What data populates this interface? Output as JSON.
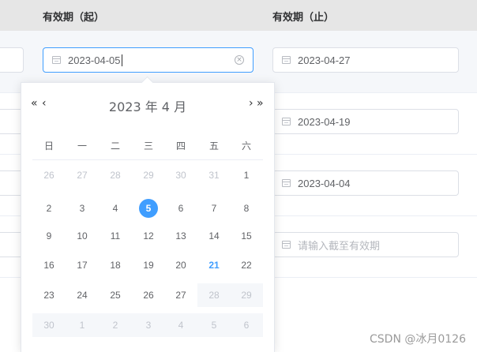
{
  "table": {
    "headers": [
      "有效期（起）",
      "有效期（止）"
    ]
  },
  "start_inputs": [
    {
      "value": "2023-04-05",
      "focused": true
    }
  ],
  "end_inputs": [
    {
      "value": "2023-04-27"
    },
    {
      "value": "2023-04-19"
    },
    {
      "value": "2023-04-04"
    },
    {
      "value": "",
      "placeholder": "请输入截至有效期"
    }
  ],
  "datepicker": {
    "prev_year": "«",
    "prev_month": "‹",
    "next_month": "›",
    "next_year": "»",
    "title": "2023 年  4 月",
    "weekdays": [
      "日",
      "一",
      "二",
      "三",
      "四",
      "五",
      "六"
    ],
    "weeks": [
      [
        {
          "d": "26",
          "s": "muted"
        },
        {
          "d": "27",
          "s": "muted"
        },
        {
          "d": "28",
          "s": "muted"
        },
        {
          "d": "29",
          "s": "muted"
        },
        {
          "d": "30",
          "s": "muted"
        },
        {
          "d": "31",
          "s": "muted"
        },
        {
          "d": "1",
          "s": ""
        }
      ],
      [
        {
          "d": "2",
          "s": ""
        },
        {
          "d": "3",
          "s": ""
        },
        {
          "d": "4",
          "s": ""
        },
        {
          "d": "5",
          "s": "selected"
        },
        {
          "d": "6",
          "s": ""
        },
        {
          "d": "7",
          "s": ""
        },
        {
          "d": "8",
          "s": ""
        }
      ],
      [
        {
          "d": "9",
          "s": ""
        },
        {
          "d": "10",
          "s": ""
        },
        {
          "d": "11",
          "s": ""
        },
        {
          "d": "12",
          "s": ""
        },
        {
          "d": "13",
          "s": ""
        },
        {
          "d": "14",
          "s": ""
        },
        {
          "d": "15",
          "s": ""
        }
      ],
      [
        {
          "d": "16",
          "s": ""
        },
        {
          "d": "17",
          "s": ""
        },
        {
          "d": "18",
          "s": ""
        },
        {
          "d": "19",
          "s": ""
        },
        {
          "d": "20",
          "s": ""
        },
        {
          "d": "21",
          "s": "today"
        },
        {
          "d": "22",
          "s": ""
        }
      ],
      [
        {
          "d": "23",
          "s": ""
        },
        {
          "d": "24",
          "s": ""
        },
        {
          "d": "25",
          "s": ""
        },
        {
          "d": "26",
          "s": ""
        },
        {
          "d": "27",
          "s": ""
        },
        {
          "d": "28",
          "s": "disabled"
        },
        {
          "d": "29",
          "s": "disabled"
        }
      ],
      [
        {
          "d": "30",
          "s": "disabled"
        },
        {
          "d": "1",
          "s": "disabled"
        },
        {
          "d": "2",
          "s": "disabled"
        },
        {
          "d": "3",
          "s": "disabled"
        },
        {
          "d": "4",
          "s": "disabled"
        },
        {
          "d": "5",
          "s": "disabled"
        },
        {
          "d": "6",
          "s": "disabled"
        }
      ]
    ]
  },
  "watermark": "CSDN @冰月0126",
  "colors": {
    "accent": "#409eff",
    "header_bg": "#e6e6e6",
    "disabled_bg": "#f5f7fa"
  }
}
